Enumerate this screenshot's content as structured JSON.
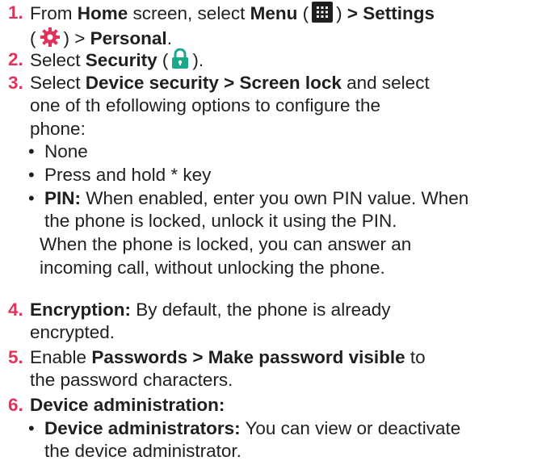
{
  "steps": {
    "s1": {
      "num": "1.",
      "t1": "From ",
      "b1": "Home",
      "t2": " screen, select ",
      "b2": "Menu",
      "t3": " (",
      "t4": ") ",
      "b3": "> Settings",
      "l2a": "(",
      "l2b": ") > ",
      "b4": "Personal",
      "t5": "."
    },
    "s2": {
      "num": "2.",
      "t1": "Select ",
      "b1": "Security",
      "t2": " (",
      "t3": ")."
    },
    "s3": {
      "num": "3.",
      "t1": "Select ",
      "b1": "Device security > Screen lock",
      "t2": "  and select",
      "l2": "one of th efollowing options to configure the",
      "l3": "phone:",
      "bullets": {
        "none": "None",
        "press": "Press and hold * key",
        "pin_b": "PIN:",
        "pin_t": " When enabled, enter you own PIN value. When",
        "pin_l2": "the phone is locked, unlock it using the PIN.",
        "note1": "When the phone is locked, you can answer an",
        "note2": "incoming call, without unlocking the phone."
      }
    },
    "s4": {
      "num": "4.",
      "b1": "Encryption:",
      "t1": " By default, the phone is already",
      "l2": "encrypted."
    },
    "s5": {
      "num": "5.",
      "t1": "Enable ",
      "b1": "Passwords > Make password visible",
      "t2": " to",
      "l2": "the password characters."
    },
    "s6": {
      "num": "6.",
      "b1": "Device administration:",
      "bullet_b": "Device administrators:",
      "bullet_t": " You can view or deactivate",
      "bullet_l2": "the device administrator."
    }
  },
  "icons": {
    "menu": "grid-menu-icon",
    "settings": "gear-icon",
    "security": "lock-icon"
  },
  "colors": {
    "step_number": "#e0335a",
    "settings_icon": "#e0335a",
    "security_icon": "#1aa88a",
    "menu_icon": "#1f1f1f"
  }
}
